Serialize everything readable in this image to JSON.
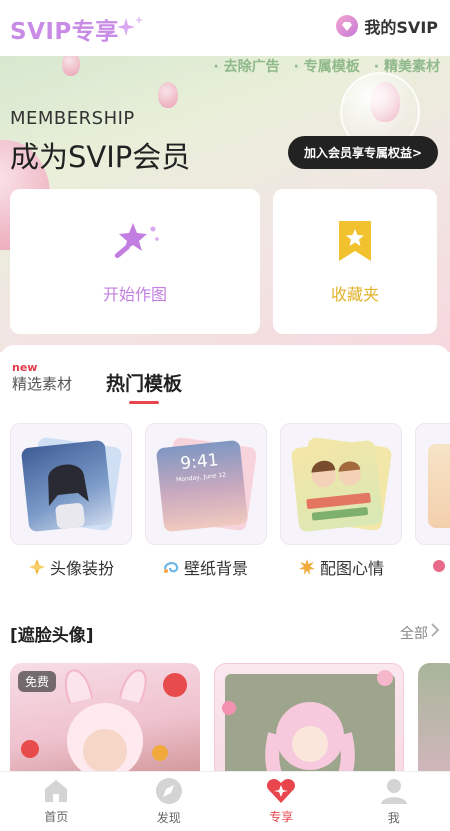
{
  "header": {
    "brand": "SVIP专享",
    "my_svip": "我的SVIP"
  },
  "hero": {
    "tags": [
      "去除广告",
      "专属模板",
      "精美素材"
    ],
    "membership": "MEMBERSHIP",
    "title": "成为SVIP会员",
    "join_button": "加入会员享专属权益>",
    "actions": [
      {
        "label": "开始作图",
        "icon": "magic-wand-icon"
      },
      {
        "label": "收藏夹",
        "icon": "bookmark-star-icon"
      }
    ]
  },
  "tabs": {
    "new_badge": "new",
    "items": [
      "精选素材",
      "热门模板"
    ],
    "active": "热门模板"
  },
  "templates": [
    {
      "label": "头像装扮",
      "icon": "sparkle-diamond-icon"
    },
    {
      "label": "壁纸背景",
      "icon": "swirl-icon"
    },
    {
      "label": "配图心情",
      "icon": "burst-icon"
    }
  ],
  "wallpaper_preview": {
    "time": "9:41",
    "date": "Monday, June 12"
  },
  "section": {
    "title": "[遮脸头像]",
    "all_label": "全部",
    "free_badge": "免费"
  },
  "bottom_nav": [
    {
      "label": "首页",
      "icon": "home-icon"
    },
    {
      "label": "发现",
      "icon": "compass-icon"
    },
    {
      "label": "专享",
      "icon": "diamond-heart-icon",
      "active": true
    },
    {
      "label": "我",
      "icon": "person-icon"
    }
  ],
  "colors": {
    "brand_purple": "#c88be6",
    "accent_red": "#e8454d",
    "action_yellow": "#e2b22a"
  }
}
